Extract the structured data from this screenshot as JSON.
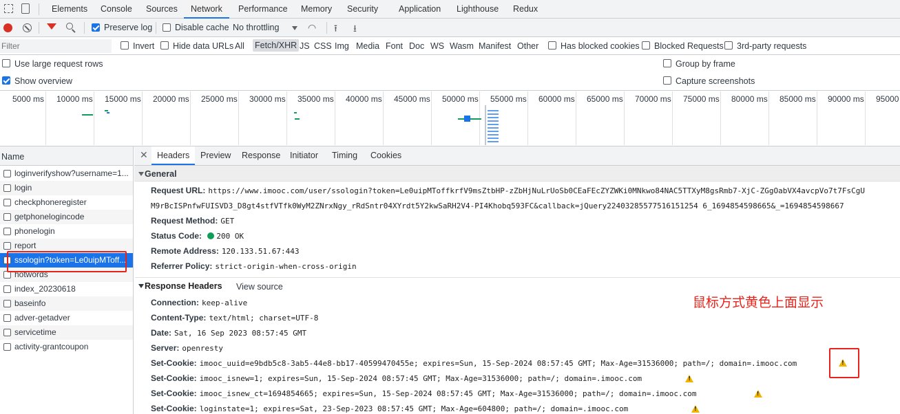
{
  "top_tabs": [
    "Elements",
    "Console",
    "Sources",
    "Network",
    "Performance",
    "Memory",
    "Security",
    "Application",
    "Lighthouse",
    "Redux"
  ],
  "toolbar": {
    "preserve_log": "Preserve log",
    "disable_cache": "Disable cache",
    "throttling": "No throttling"
  },
  "filter_bar": {
    "placeholder": "Filter",
    "invert": "Invert",
    "hide_data_urls": "Hide data URLs",
    "types": [
      "All",
      "Fetch/XHR",
      "JS",
      "CSS",
      "Img",
      "Media",
      "Font",
      "Doc",
      "WS",
      "Wasm",
      "Manifest",
      "Other"
    ],
    "has_blocked_cookies": "Has blocked cookies",
    "blocked_requests": "Blocked Requests",
    "third_party": "3rd-party requests"
  },
  "options": {
    "large_rows": "Use large request rows",
    "show_overview": "Show overview",
    "group_by_frame": "Group by frame",
    "capture_screenshots": "Capture screenshots"
  },
  "timeline_ticks": [
    "5000 ms",
    "10000 ms",
    "15000 ms",
    "20000 ms",
    "25000 ms",
    "30000 ms",
    "35000 ms",
    "40000 ms",
    "45000 ms",
    "50000 ms",
    "55000 ms",
    "60000 ms",
    "65000 ms",
    "70000 ms",
    "75000 ms",
    "80000 ms",
    "85000 ms",
    "90000 ms",
    "95000"
  ],
  "request_list": {
    "header": "Name",
    "items": [
      "loginverifyshow?username=1...",
      "login",
      "checkphoneregister",
      "getphonelogincode",
      "phonelogin",
      "report",
      "ssologin?token=Le0uipMToff...",
      "hotwords",
      "index_20230618",
      "baseinfo",
      "adver-getadver",
      "servicetime",
      "activity-grantcoupon"
    ],
    "selected_index": 6
  },
  "detail_tabs": [
    "Headers",
    "Preview",
    "Response",
    "Initiator",
    "Timing",
    "Cookies"
  ],
  "general": {
    "title": "General",
    "request_url_label": "Request URL:",
    "request_url_line1": "https://www.imooc.com/user/ssologin?token=Le0uipMToffkrfV9msZtbHP-zZbHjNuLrUoSb0CEaFEcZYZWKi0MNkwo84NAC5TTXyM8gsRmb7-XjC-ZGgOabVX4avcpVo7t7FsCgU",
    "request_url_line2": "M9rBcISPnfwFUISVD3_D8gt4stfVTfk0WyM2ZNrxNgy_rRdSntr04XYrdt5Y2kwSaRH2V4-PI4Khobq593FC&callback=jQuery22403285577516151254 6_1694854598665&_=1694854598667",
    "request_method_label": "Request Method:",
    "request_method": "GET",
    "status_code_label": "Status Code:",
    "status_code": "200 OK",
    "remote_address_label": "Remote Address:",
    "remote_address": "120.133.51.67:443",
    "referrer_policy_label": "Referrer Policy:",
    "referrer_policy": "strict-origin-when-cross-origin"
  },
  "response_headers": {
    "title": "Response Headers",
    "view_source": "View source",
    "rows": [
      {
        "k": "Connection:",
        "v": "keep-alive"
      },
      {
        "k": "Content-Type:",
        "v": "text/html; charset=UTF-8"
      },
      {
        "k": "Date:",
        "v": "Sat, 16 Sep 2023 08:57:45 GMT"
      },
      {
        "k": "Server:",
        "v": "openresty"
      },
      {
        "k": "Set-Cookie:",
        "v": "imooc_uuid=e9bdb5c8-3ab5-44e8-bb17-40599470455e; expires=Sun, 15-Sep-2024 08:57:45 GMT; Max-Age=31536000; path=/; domain=.imooc.com"
      },
      {
        "k": "Set-Cookie:",
        "v": "imooc_isnew=1; expires=Sun, 15-Sep-2024 08:57:45 GMT; Max-Age=31536000; path=/; domain=.imooc.com"
      },
      {
        "k": "Set-Cookie:",
        "v": "imooc_isnew_ct=1694854665; expires=Sun, 15-Sep-2024 08:57:45 GMT; Max-Age=31536000; path=/; domain=.imooc.com"
      },
      {
        "k": "Set-Cookie:",
        "v": "loginstate=1; expires=Sat, 23-Sep-2023 08:57:45 GMT; Max-Age=604800; path=/; domain=.imooc.com"
      }
    ]
  },
  "annotation": "鼠标方式黄色上面显示",
  "colors": {
    "accent": "#1a73e8",
    "annotation_red": "#e8231b",
    "warning": "#f0b400",
    "status_green": "#0f9d58"
  }
}
